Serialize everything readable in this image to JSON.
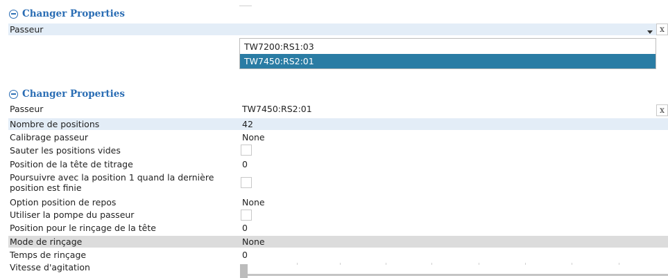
{
  "section1": {
    "title": "Changer Properties",
    "passeur_label": "Passeur",
    "clear_label": "x",
    "dropdown_options": [
      "TW7200:RS1:03",
      "TW7450:RS2:01"
    ],
    "selected_index": 1
  },
  "section2": {
    "title": "Changer Properties",
    "clear_label": "x",
    "rows": {
      "passeur": {
        "label": "Passeur",
        "value": "TW7450:RS2:01"
      },
      "nombre_positions": {
        "label": "Nombre de positions",
        "value": "42"
      },
      "calibrage": {
        "label": "Calibrage passeur",
        "value": "None"
      },
      "sauter": {
        "label": "Sauter les positions vides",
        "checked": false
      },
      "position_tete": {
        "label": "Position de la tête de titrage",
        "value": "0"
      },
      "poursuivre": {
        "label": "Poursuivre avec la position 1 quand la dernière position est finie",
        "checked": false
      },
      "option_repos": {
        "label": "Option position de repos",
        "value": "None"
      },
      "pompe": {
        "label": "Utiliser la pompe du passeur",
        "checked": false
      },
      "rincage_tete": {
        "label": "Position pour le rinçage de la tête",
        "value": "0"
      },
      "mode_rincage": {
        "label": "Mode de rinçage",
        "value": "None"
      },
      "temps_rincage": {
        "label": "Temps de rinçage",
        "value": "0"
      },
      "vitesse_agitation": {
        "label": "Vitesse d'agitation",
        "slider_value": 0
      }
    }
  },
  "colors": {
    "header_blue": "#2a6db4",
    "selected_option_bg": "#2a7ca4",
    "highlight_row_blue": "#e3edf7",
    "highlight_row_grey": "#dcdcdc"
  },
  "icons": [
    "collapse-minus-icon",
    "dropdown-caret-icon",
    "clear-x-icon"
  ]
}
